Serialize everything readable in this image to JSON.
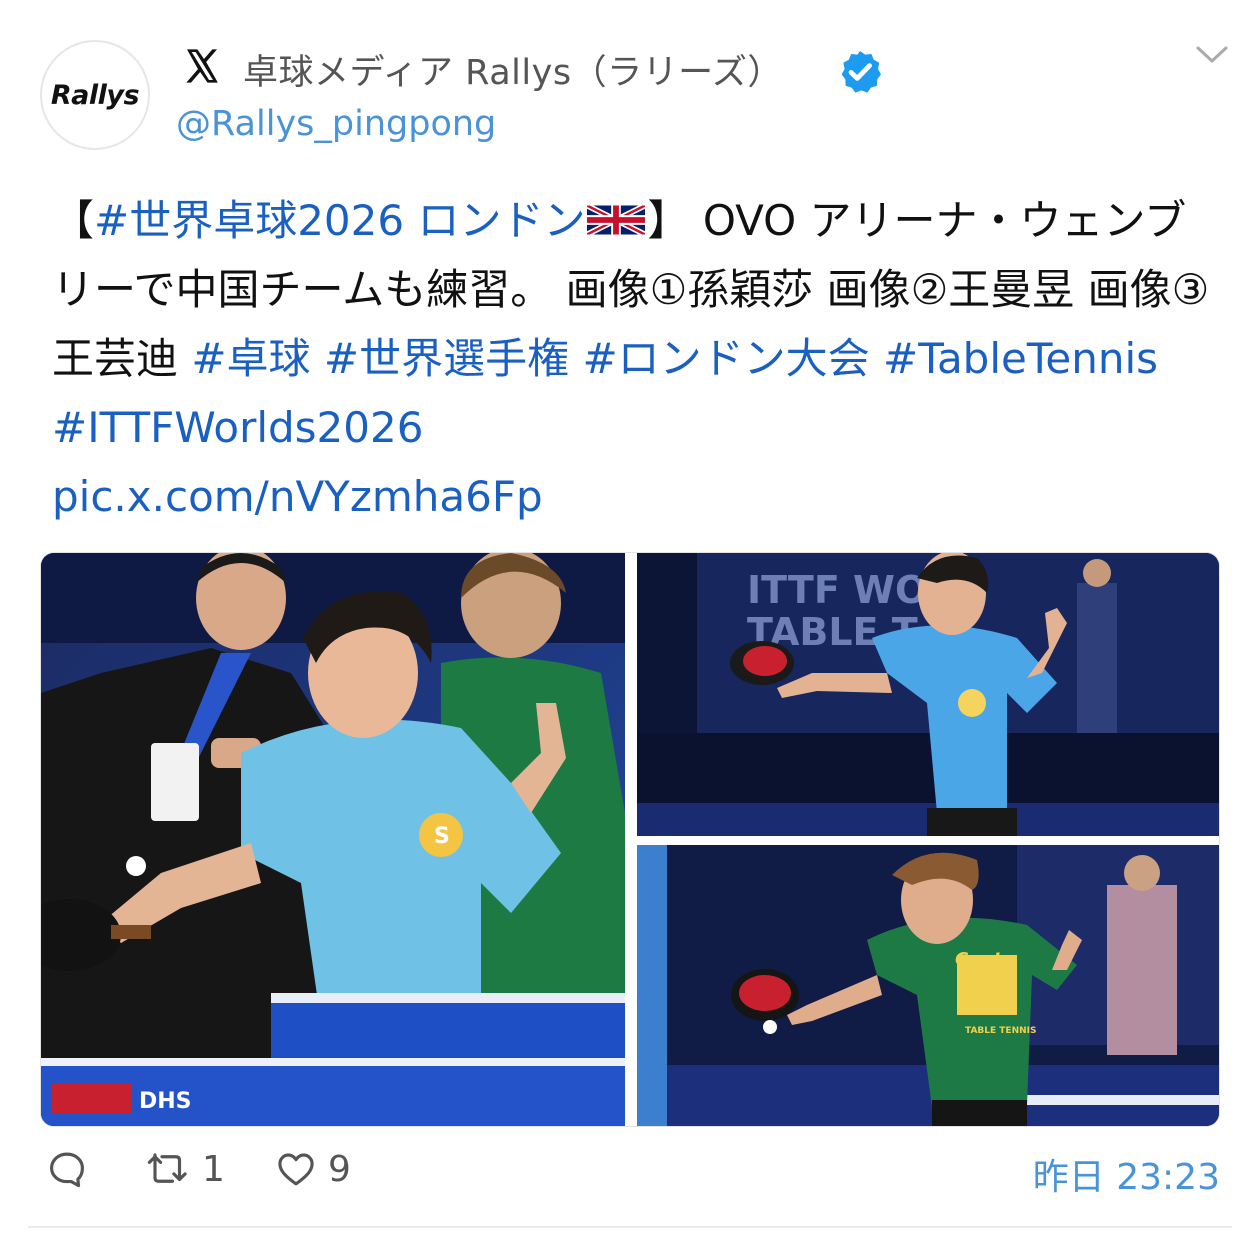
{
  "author": {
    "avatar_text": "Rallys",
    "name": "卓球メディア Rallys（ラリーズ）",
    "handle": "@Rallys_pingpong",
    "platform_icon": "x-logo-icon",
    "verified_icon": "verified-badge-icon"
  },
  "tweet": {
    "open_bracket": "【",
    "hashtag_event": "#世界卓球2026",
    "event_city": " ロンドン",
    "close_bracket": "】",
    "body": " OVO アリーナ・ウェンブリーで中国チームも練習。 画像①孫穎莎 画像②王曼昱 画像③王芸迪 ",
    "hashtags": [
      "#卓球",
      "#世界選手権",
      "#ロンドン大会",
      "#TableTennis",
      "#ITTFWorlds2026"
    ],
    "link": "pic.x.com/nVYzmha6Fp"
  },
  "photos": {
    "photo1_desc": "Player in light blue shirt practicing forehand",
    "photo2_desc": "Player in light blue shirt at ITTF Worlds venue",
    "photo3_desc": "Player in green shirt practicing forehand",
    "banner_text_1": "ITTF WO",
    "banner_text_2": "TABLE T",
    "shirt_text": "Centr",
    "shirt_sub": "TABLE TENNIS",
    "board_text": "DHS"
  },
  "actions": {
    "reply_count": "",
    "retweet_count": "1",
    "like_count": "9",
    "timestamp": "昨日 23:23"
  },
  "colors": {
    "link": "#1a5fc2",
    "handle": "#4a93d8",
    "verified": "#1d9bf0"
  }
}
